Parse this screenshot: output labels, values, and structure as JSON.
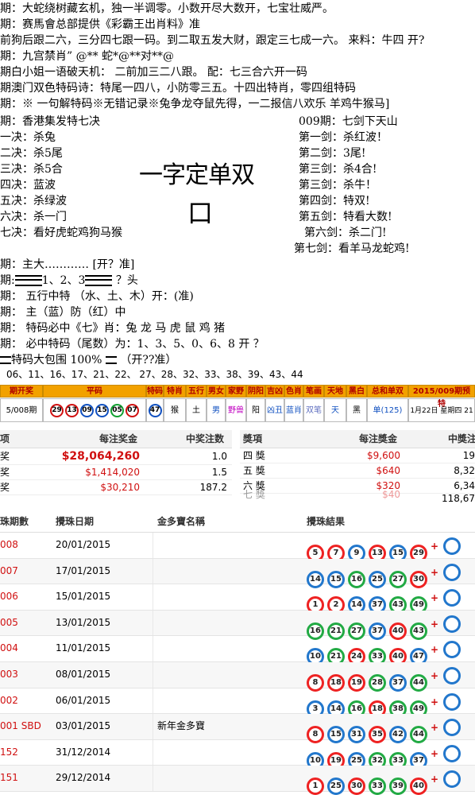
{
  "top_lines": [
    "期：大蛇绕树藏玄机，独一半调零。小数开尽大数开，七宝壮威严。",
    "期：赛馬會总部提供《彩霸王出肖料》准",
    "前狗后跟二六，三分四七跟一码。到二取五发大财，跟定三七成一六。 来料：牛四  开?",
    "期：九宫禁肖” @** 蛇*@**对**@",
    "期白小姐一语破天机： 二前加三二八跟。 配：七三合六开一码",
    "期澳门双色特码诗：特尾一四八，小防零三五。十四出特肖，零四组特码",
    "期：※ 一句解特码※无错记录※兔争龙夺鼠先得，一二报信八欢乐 羊鸡牛猴马]"
  ],
  "left_title": "期：香港集发特七决",
  "left_items": [
    "一决：杀兔",
    "二决：杀5尾",
    "三决：杀5合",
    "四决：蓝波",
    "五决：杀绿波",
    "六决：杀一门",
    "七决：看好虎蛇鸡狗马猴"
  ],
  "right_title": "009期：七剑下天山",
  "right_items": [
    "第一剑：杀红波！",
    "第二剑：3尾!",
    "第三剑：杀4合!",
    "第三剑：杀牛！",
    "第四剑：特双!",
    "第五剑：特看大数!",
    "第六剑：杀二门!",
    "第七剑：看羊马龙蛇鸡!"
  ],
  "big_text": "一字定单双",
  "big_text2": "口",
  "mid_lines": {
    "l1": "期：主大………… [开？准]",
    "l2a": "期:",
    "l2b": "1、2、3",
    "l2c": "？头",
    "l3": "期： 五行中特  （水、土、木）开：(准)",
    "l4": "期： 主（蓝）防（红）中",
    "l5": "期： 特码必中《七》肖：兔 龙 马 虎 鼠 鸡  猪",
    "l6": "期： 必中特码（尾数）为：1、3、5、0、6、8     开 ？",
    "l7a": "特码大包围 100%",
    "l7b": "（开??准）"
  },
  "numbers_line": "06、11、16、17、21、22、 27、28、32、33、38、39、43、44",
  "info_table": {
    "headers": [
      "期开奖",
      "平码",
      "特码",
      "特肖",
      "五行",
      "男女",
      "家野",
      "阴阳",
      "吉凶",
      "色肖",
      "笔画",
      "天地",
      "黑白",
      "总和单双",
      "2015/009期预特"
    ],
    "period": "5/008期",
    "balls": [
      {
        "n": "29",
        "c": "red"
      },
      {
        "n": "13",
        "c": "red"
      },
      {
        "n": "09",
        "c": "blue"
      },
      {
        "n": "15",
        "c": "blue"
      },
      {
        "n": "05",
        "c": "green"
      },
      {
        "n": "07",
        "c": "red"
      }
    ],
    "special": "47",
    "attrs": [
      "猴",
      "土",
      "男",
      "野兽",
      "阳",
      "凶丑",
      "蓝肖",
      "双笔",
      "天",
      "黑",
      "单(125)",
      "1月22日 星期四 21"
    ]
  },
  "prize_left": {
    "headers": [
      "项",
      "每注奖金",
      "中奖注数"
    ],
    "rows": [
      {
        "name": "奖",
        "amount": "$28,064,260",
        "count": "1.0"
      },
      {
        "name": "奖",
        "amount": "$1,414,020",
        "count": "1.5"
      },
      {
        "name": "奖",
        "amount": "$30,210",
        "count": "187.2"
      }
    ]
  },
  "prize_right": {
    "headers": [
      "獎項",
      "每注獎金",
      "中獎注"
    ],
    "rows": [
      {
        "name": "四 獎",
        "amount": "$9,600",
        "count": "19"
      },
      {
        "name": "五 獎",
        "amount": "$640",
        "count": "8,32"
      },
      {
        "name": "六 獎",
        "amount": "$320",
        "count": "6,34"
      },
      {
        "name": "七 獎",
        "amount": "$40",
        "count": "118,67"
      }
    ]
  },
  "draws": {
    "headers": [
      "珠期數",
      "攪珠日期",
      "金多寶名稱",
      "攪珠結果"
    ],
    "rows": [
      {
        "id": "008",
        "date": "20/01/2015",
        "name": "",
        "balls": [
          [
            "5",
            "red"
          ],
          [
            "7",
            "red"
          ],
          [
            "9",
            "blue"
          ],
          [
            "13",
            "red"
          ],
          [
            "15",
            "blue"
          ],
          [
            "29",
            "red"
          ]
        ]
      },
      {
        "id": "007",
        "date": "17/01/2015",
        "name": "",
        "balls": [
          [
            "14",
            "blue"
          ],
          [
            "15",
            "blue"
          ],
          [
            "16",
            "green"
          ],
          [
            "25",
            "blue"
          ],
          [
            "27",
            "green"
          ],
          [
            "30",
            "red"
          ]
        ]
      },
      {
        "id": "006",
        "date": "15/01/2015",
        "name": "",
        "balls": [
          [
            "1",
            "red"
          ],
          [
            "2",
            "red"
          ],
          [
            "14",
            "blue"
          ],
          [
            "37",
            "blue"
          ],
          [
            "43",
            "green"
          ],
          [
            "49",
            "green"
          ]
        ]
      },
      {
        "id": "005",
        "date": "13/01/2015",
        "name": "",
        "balls": [
          [
            "16",
            "green"
          ],
          [
            "21",
            "green"
          ],
          [
            "27",
            "green"
          ],
          [
            "37",
            "blue"
          ],
          [
            "40",
            "red"
          ],
          [
            "43",
            "green"
          ]
        ]
      },
      {
        "id": "004",
        "date": "11/01/2015",
        "name": "",
        "balls": [
          [
            "10",
            "blue"
          ],
          [
            "21",
            "green"
          ],
          [
            "24",
            "red"
          ],
          [
            "33",
            "green"
          ],
          [
            "40",
            "red"
          ],
          [
            "47",
            "blue"
          ]
        ]
      },
      {
        "id": "003",
        "date": "08/01/2015",
        "name": "",
        "balls": [
          [
            "8",
            "red"
          ],
          [
            "18",
            "red"
          ],
          [
            "19",
            "red"
          ],
          [
            "28",
            "green"
          ],
          [
            "37",
            "blue"
          ],
          [
            "44",
            "green"
          ]
        ]
      },
      {
        "id": "002",
        "date": "06/01/2015",
        "name": "",
        "balls": [
          [
            "3",
            "blue"
          ],
          [
            "14",
            "blue"
          ],
          [
            "16",
            "green"
          ],
          [
            "18",
            "red"
          ],
          [
            "38",
            "green"
          ],
          [
            "49",
            "green"
          ]
        ]
      },
      {
        "id": "001 SBD",
        "date": "03/01/2015",
        "name": "新年金多寶",
        "balls": [
          [
            "8",
            "red"
          ],
          [
            "15",
            "blue"
          ],
          [
            "31",
            "blue"
          ],
          [
            "35",
            "red"
          ],
          [
            "42",
            "blue"
          ],
          [
            "44",
            "green"
          ]
        ]
      },
      {
        "id": "152",
        "date": "31/12/2014",
        "name": "",
        "balls": [
          [
            "10",
            "blue"
          ],
          [
            "19",
            "red"
          ],
          [
            "25",
            "blue"
          ],
          [
            "32",
            "green"
          ],
          [
            "33",
            "green"
          ],
          [
            "37",
            "blue"
          ]
        ]
      },
      {
        "id": "151",
        "date": "29/12/2014",
        "name": "",
        "balls": [
          [
            "1",
            "red"
          ],
          [
            "25",
            "blue"
          ],
          [
            "30",
            "red"
          ],
          [
            "33",
            "green"
          ],
          [
            "39",
            "green"
          ],
          [
            "40",
            "red"
          ]
        ]
      }
    ]
  }
}
